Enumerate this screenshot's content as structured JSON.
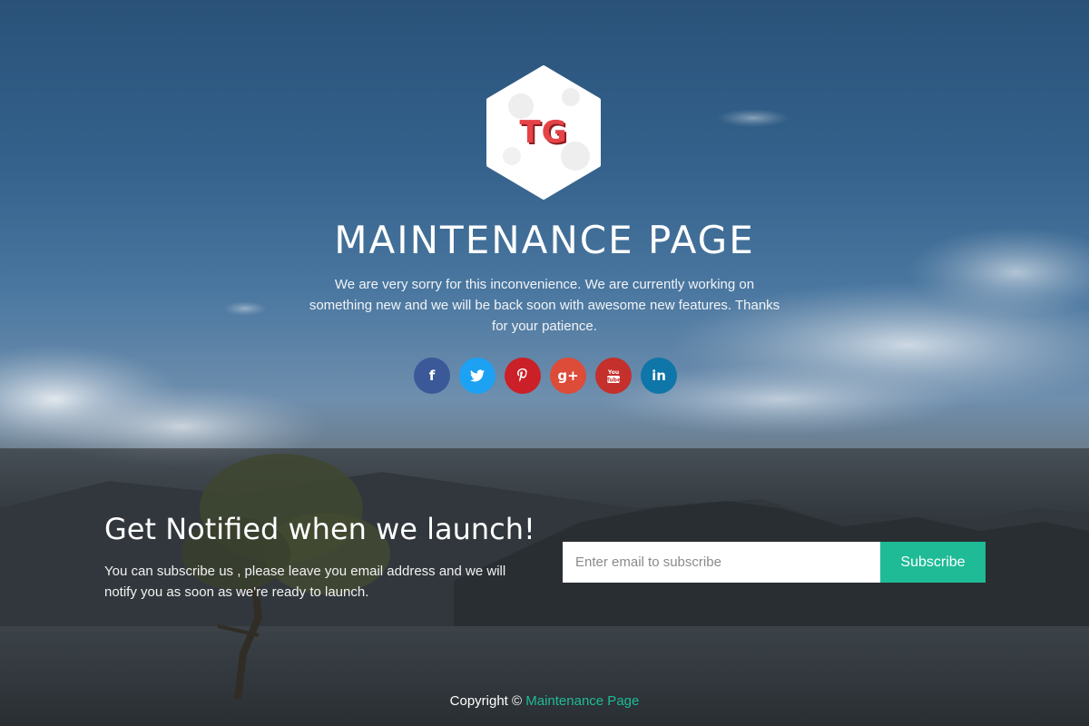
{
  "logo": {
    "text": "TG",
    "icon": "hexagon-logo"
  },
  "hero": {
    "title": "MAINTENANCE  PAGE",
    "description": "We are very sorry for this inconvenience. We are currently working on something new and we will be back soon with awesome new features. Thanks for your patience."
  },
  "socials": [
    {
      "name": "facebook",
      "glyph": "f",
      "color": "#3b5998"
    },
    {
      "name": "twitter",
      "glyph": "t",
      "color": "#1da1f2"
    },
    {
      "name": "pinterest",
      "glyph": "P",
      "color": "#cb2027"
    },
    {
      "name": "google-plus",
      "glyph": "g+",
      "color": "#dd4b39"
    },
    {
      "name": "youtube",
      "glyph": "You",
      "color": "#c4302b"
    },
    {
      "name": "linkedin",
      "glyph": "in",
      "color": "#0e76a8"
    }
  ],
  "notify": {
    "title": "Get Notified when we launch!",
    "description": "You can subscribe us , please leave you email address and we will notify you as soon as we're ready to launch.",
    "email_placeholder": "Enter email to subscribe",
    "email_value": "",
    "subscribe_label": "Subscribe"
  },
  "footer": {
    "prefix": "Copyright © ",
    "link_text": "Maintenance Page"
  },
  "colors": {
    "accent": "#1fbb97",
    "logo_red": "#e54348"
  }
}
